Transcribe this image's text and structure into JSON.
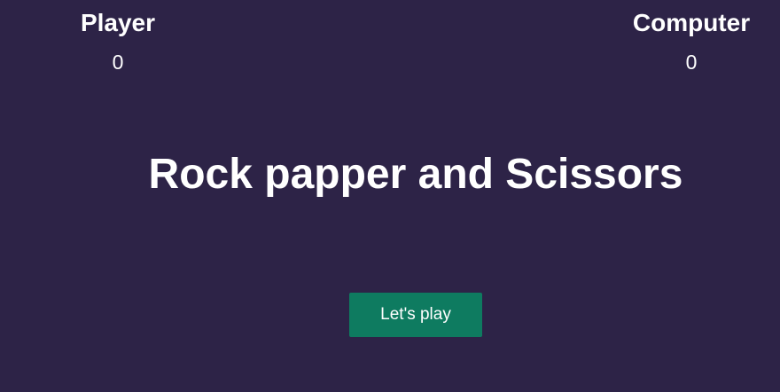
{
  "scoreboard": {
    "player": {
      "label": "Player",
      "score": "0"
    },
    "computer": {
      "label": "Computer",
      "score": "0"
    }
  },
  "title": "Rock papper and Scissors",
  "play_button": {
    "label": "Let's play"
  },
  "colors": {
    "background": "#2d2347",
    "button": "#0e7b60",
    "text": "#ffffff"
  }
}
